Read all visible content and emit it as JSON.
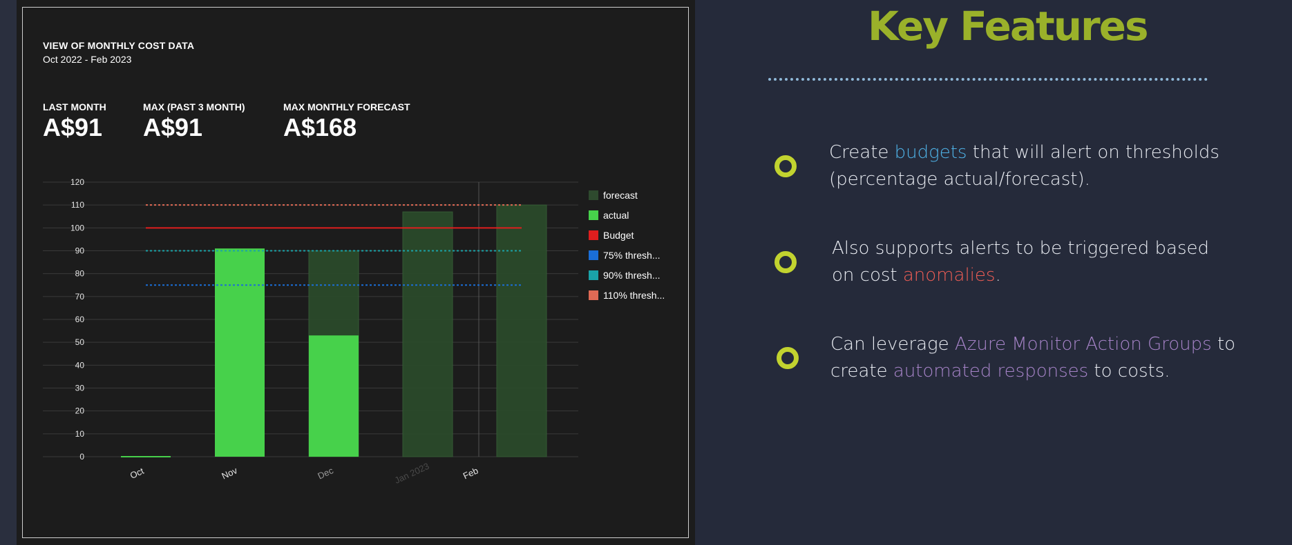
{
  "panel": {
    "title": "VIEW OF MONTHLY COST DATA",
    "subtitle": "Oct 2022 - Feb 2023",
    "kpis": [
      {
        "label": "LAST MONTH",
        "value": "A$91"
      },
      {
        "label": "MAX (PAST 3 MONTH)",
        "value": "A$91"
      },
      {
        "label": "MAX MONTHLY FORECAST",
        "value": "A$168"
      }
    ]
  },
  "chart_data": {
    "type": "bar",
    "categories": [
      "Oct",
      "Nov",
      "Dec",
      "Jan 2023",
      "Feb"
    ],
    "ylim": [
      0,
      120
    ],
    "yticks": [
      0,
      10,
      20,
      30,
      40,
      50,
      60,
      70,
      80,
      90,
      100,
      110,
      120
    ],
    "grid": true,
    "legend_position": "right",
    "series": [
      {
        "name": "forecast",
        "type": "bar",
        "color": "#2a4a2a",
        "values": [
          0,
          0,
          90,
          107,
          110
        ]
      },
      {
        "name": "actual",
        "type": "bar",
        "color": "#47d14b",
        "values": [
          0,
          91,
          53,
          0,
          0
        ]
      },
      {
        "name": "Budget",
        "type": "line",
        "color": "#e01e1e",
        "value": 100
      },
      {
        "name": "75% thresh...",
        "type": "line",
        "color": "#1a6ed8",
        "value": 75
      },
      {
        "name": "90% thresh...",
        "type": "line",
        "color": "#1aa3a8",
        "value": 90
      },
      {
        "name": "110% thresh...",
        "type": "line",
        "color": "#e06a55",
        "value": 110
      }
    ]
  },
  "features": {
    "title": "Key Features",
    "items": [
      {
        "line1_pre": "Create ",
        "line1_hl": "budgets",
        "line1_post": " that will alert on thresholds",
        "line2_pre": "(percentage actual/forecast).",
        "line2_hl": "",
        "line2_post": ""
      },
      {
        "line1_pre": "Also supports alerts to be triggered based",
        "line1_hl": "",
        "line1_post": "",
        "line2_pre": "on cost ",
        "line2_hl": "anomalies",
        "line2_post": "."
      },
      {
        "line1_pre": "Can leverage ",
        "line1_hl": "Azure Monitor Action Groups",
        "line1_post": " to",
        "line2_pre": "create ",
        "line2_hl": "automated responses",
        "line2_post": " to costs."
      }
    ]
  },
  "colors": {
    "accent_title": "#9ab12a",
    "bullet": "#c2d32f",
    "highlight_blue": "#4fb3e8",
    "highlight_red": "#ee5d55",
    "highlight_purple": "#a784c9"
  }
}
